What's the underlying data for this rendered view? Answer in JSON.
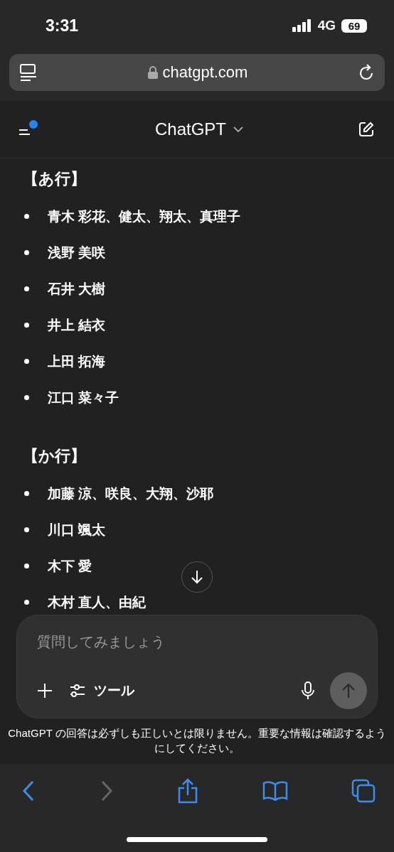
{
  "status_bar": {
    "time": "3:31",
    "network": "4G",
    "battery": "69"
  },
  "url_bar": {
    "url": "chatgpt.com"
  },
  "header": {
    "title": "ChatGPT",
    "notification_dot": true
  },
  "sections": [
    {
      "heading": "【あ行】",
      "items": [
        "青木 彩花、健太、翔太、真理子",
        "浅野 美咲",
        "石井 大樹",
        "井上 結衣",
        "上田 拓海",
        "江口 菜々子"
      ]
    },
    {
      "heading": "【か行】",
      "items": [
        "加藤 涼、咲良、大翔、沙耶",
        "川口 颯太",
        "木下 愛",
        "木村 直人、由紀"
      ]
    }
  ],
  "composer": {
    "placeholder": "質問してみましょう",
    "tools_label": "ツール",
    "send_disabled": true
  },
  "disclaimer": "ChatGPT の回答は必ずしも正しいとは限りません。重要な情報は確認するようにしてください。",
  "toolbar": {
    "back_disabled": false,
    "forward_disabled": true
  }
}
